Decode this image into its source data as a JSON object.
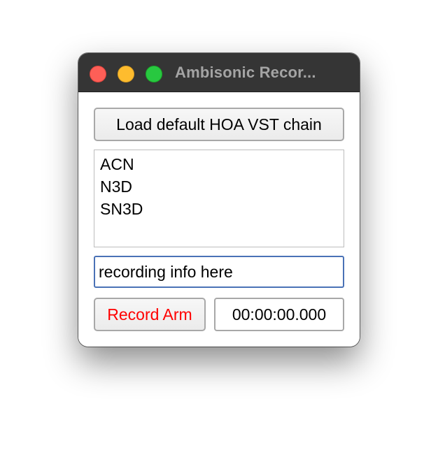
{
  "window": {
    "title": "Ambisonic Recor..."
  },
  "controls": {
    "load_button_label": "Load default HOA VST chain",
    "formats": [
      "ACN",
      "N3D",
      "SN3D"
    ],
    "info_field_value": "recording info here",
    "record_arm_label": "Record Arm",
    "record_arm_color": "#ff0000",
    "timecode": "00:00:00.000"
  },
  "colors": {
    "titlebar": "#353535",
    "title_text": "#a4a4a4",
    "close": "#fe5f57",
    "minimize": "#febc2e",
    "maximize": "#28c840",
    "focus_ring": "#4a72b6"
  }
}
